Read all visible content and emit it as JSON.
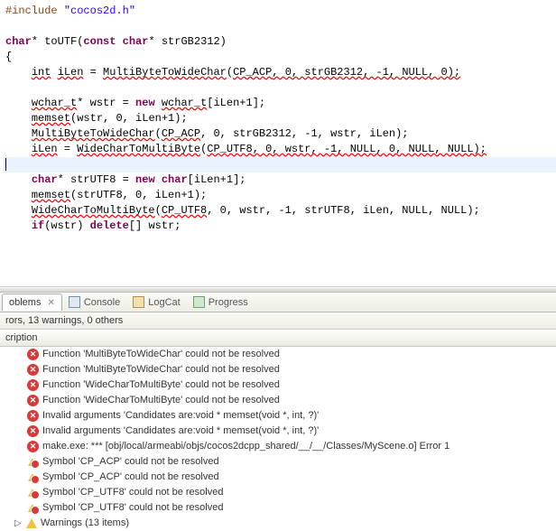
{
  "code": {
    "line1_pre": "#include ",
    "line1_str": "\"cocos2d.h\"",
    "line3_kw1": "char",
    "line3_rest": "* toUTF(",
    "line3_kw2": "const",
    "line3_rest2": " ",
    "line3_kw3": "char",
    "line3_rest3": "* strGB2312)",
    "line4": "{",
    "line5_a": "    ",
    "line5_w1": "int",
    "line5_b": " ",
    "line5_w2": "iLen",
    "line5_c": " = ",
    "line5_w3": "MultiByteToWideChar",
    "line5_d": "(",
    "line5_w4": "CP_ACP",
    "line5_e": ", 0, strGB2312, -1, NULL, 0);",
    "line7_a": "    ",
    "line7_w1": "wchar_t",
    "line7_b": "* wstr = ",
    "line7_kw": "new",
    "line7_c": " ",
    "line7_w2": "wchar_t",
    "line7_d": "[iLen+1];",
    "line8_a": "    ",
    "line8_w1": "memset",
    "line8_b": "(wstr, 0, iLen+1);",
    "line9_a": "    ",
    "line9_w1": "MultiByteToWideChar",
    "line9_b": "(",
    "line9_w2": "CP_ACP",
    "line9_c": ", 0, strGB2312, -1, wstr, iLen);",
    "line10_a": "    ",
    "line10_w1": "iLen",
    "line10_b": " = ",
    "line10_w2": "WideCharToMultiByte",
    "line10_c": "(",
    "line10_w3": "CP_UTF8",
    "line10_d": ", 0, wstr, -1, NULL, 0, NULL, NULL);",
    "line12_a": "    ",
    "line12_kw1": "char",
    "line12_b": "* strUTF8 = ",
    "line12_kw2": "new",
    "line12_c": " ",
    "line12_kw3": "char",
    "line12_d": "[iLen+1];",
    "line13_a": "    ",
    "line13_w1": "memset",
    "line13_b": "(strUTF8, 0, iLen+1);",
    "line14_a": "    ",
    "line14_w1": "WideCharToMultiByte",
    "line14_b": "(",
    "line14_w2": "CP_UTF8",
    "line14_c": ", 0, wstr, -1, strUTF8, iLen, NULL, NULL);",
    "line15_a": "    ",
    "line15_kw": "if",
    "line15_b": "(wstr) ",
    "line15_kw2": "delete",
    "line15_c": "[] wstr;"
  },
  "tabs": {
    "problems": "oblems",
    "console": "Console",
    "logcat": "LogCat",
    "progress": "Progress"
  },
  "panel": {
    "summary": "rors, 13 warnings, 0 others",
    "header": "cription",
    "warnings_group": "Warnings (13 items)"
  },
  "errors": [
    "Function 'MultiByteToWideChar' could not be resolved",
    "Function 'MultiByteToWideChar' could not be resolved",
    "Function 'WideCharToMultiByte' could not be resolved",
    "Function 'WideCharToMultiByte' could not be resolved",
    "Invalid arguments 'Candidates are:void * memset(void *, int, ?)'",
    "Invalid arguments 'Candidates are:void * memset(void *, int, ?)'",
    "make.exe: *** [obj/local/armeabi/objs/cocos2dcpp_shared/__/__/Classes/MyScene.o] Error 1"
  ],
  "symbol_errors": [
    "Symbol 'CP_ACP' could not be resolved",
    "Symbol 'CP_ACP' could not be resolved",
    "Symbol 'CP_UTF8' could not be resolved",
    "Symbol 'CP_UTF8' could not be resolved"
  ]
}
